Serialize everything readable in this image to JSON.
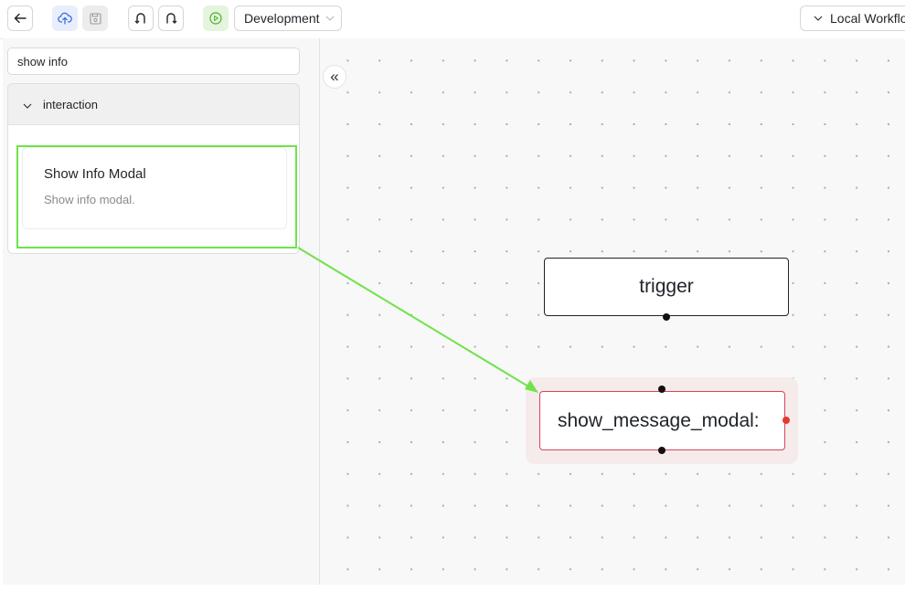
{
  "toolbar": {
    "environment_label": "Development",
    "workflow_label": "Local Workflo"
  },
  "search": {
    "value": "show info"
  },
  "group": {
    "label": "interaction",
    "items": [
      {
        "title": "Show Info Modal",
        "description": "Show info modal."
      }
    ]
  },
  "canvas": {
    "collapse_glyph": "«",
    "nodes": {
      "trigger": {
        "label": "trigger"
      },
      "modal": {
        "label": "show_message_modal:"
      }
    }
  },
  "colors": {
    "highlight": "#6ee34a",
    "selected_node_border": "#d8455a",
    "selected_node_halo": "#f5ebeb",
    "handle_red": "#e53935"
  },
  "icons": [
    "back-arrow-icon",
    "upload-cloud-icon",
    "save-icon",
    "undo-icon",
    "redo-icon",
    "play-icon",
    "chevron-down-icon"
  ]
}
